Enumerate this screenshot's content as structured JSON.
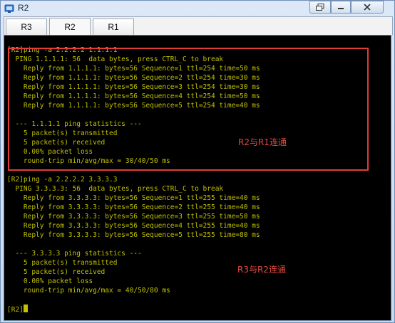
{
  "window": {
    "title": "R2"
  },
  "tabs": [
    {
      "label": "R3"
    },
    {
      "label": "R2",
      "active": true
    },
    {
      "label": "R1"
    }
  ],
  "terminal": {
    "lines": [
      "[R2]ping -a 2.2.2.2 1.1.1.1",
      "  PING 1.1.1.1: 56  data bytes, press CTRL_C to break",
      "    Reply from 1.1.1.1: bytes=56 Sequence=1 ttl=254 time=50 ms",
      "    Reply from 1.1.1.1: bytes=56 Sequence=2 ttl=254 time=30 ms",
      "    Reply from 1.1.1.1: bytes=56 Sequence=3 ttl=254 time=30 ms",
      "    Reply from 1.1.1.1: bytes=56 Sequence=4 ttl=254 time=50 ms",
      "    Reply from 1.1.1.1: bytes=56 Sequence=5 ttl=254 time=40 ms",
      "",
      "  --- 1.1.1.1 ping statistics ---",
      "    5 packet(s) transmitted",
      "    5 packet(s) received",
      "    0.00% packet loss",
      "    round-trip min/avg/max = 30/40/50 ms",
      "",
      "[R2]ping -a 2.2.2.2 3.3.3.3",
      "  PING 3.3.3.3: 56  data bytes, press CTRL_C to break",
      "    Reply from 3.3.3.3: bytes=56 Sequence=1 ttl=255 time=40 ms",
      "    Reply from 3.3.3.3: bytes=56 Sequence=2 ttl=255 time=40 ms",
      "    Reply from 3.3.3.3: bytes=56 Sequence=3 ttl=255 time=50 ms",
      "    Reply from 3.3.3.3: bytes=56 Sequence=4 ttl=255 time=40 ms",
      "    Reply from 3.3.3.3: bytes=56 Sequence=5 ttl=255 time=80 ms",
      "",
      "  --- 3.3.3.3 ping statistics ---",
      "    5 packet(s) transmitted",
      "    5 packet(s) received",
      "    0.00% packet loss",
      "    round-trip min/avg/max = 40/50/80 ms",
      "",
      "[R2]"
    ]
  },
  "annotations": {
    "note1": "R2与R1连通",
    "note2": "R3与R2连通",
    "color": "#e23d35"
  },
  "colors": {
    "terminal_bg": "#000000",
    "terminal_text": "#c2c200"
  }
}
